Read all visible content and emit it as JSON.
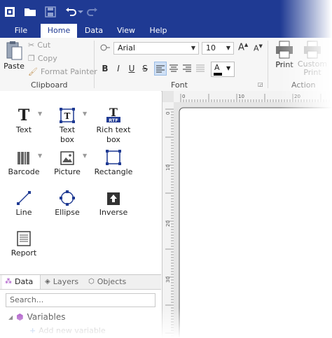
{
  "menu_tabs": [
    {
      "label": "File"
    },
    {
      "label": "Home"
    },
    {
      "label": "Data"
    },
    {
      "label": "View"
    },
    {
      "label": "Help"
    }
  ],
  "clipboard": {
    "paste_label": "Paste",
    "cut_label": "Cut",
    "copy_label": "Copy",
    "format_painter_label": "Format Painter",
    "group_label": "Clipboard"
  },
  "font": {
    "font_name": "Arial",
    "font_size": "10",
    "group_label": "Font",
    "bold": "B",
    "italic": "I",
    "underline": "U",
    "strike": "S",
    "color_letter": "A",
    "grow": "A",
    "shrink": "A"
  },
  "action": {
    "print_label": "Print",
    "custom_print_label": "Custom Print",
    "group_label": "Action"
  },
  "tools": [
    {
      "label": "Text"
    },
    {
      "label": "Text box"
    },
    {
      "label": "Rich text box"
    },
    {
      "label": "Barcode"
    },
    {
      "label": "Picture"
    },
    {
      "label": "Rectangle"
    },
    {
      "label": "Line"
    },
    {
      "label": "Ellipse"
    },
    {
      "label": "Inverse"
    },
    {
      "label": "Report"
    }
  ],
  "rtf_badge": "RTF",
  "ruler": {
    "h_labels": [
      "0",
      "10",
      "20"
    ],
    "v_labels": [
      "0",
      "10",
      "20",
      "30"
    ]
  },
  "bottom_tabs": [
    {
      "label": "Data"
    },
    {
      "label": "Layers"
    },
    {
      "label": "Objects"
    }
  ],
  "search": {
    "placeholder": "Search..."
  },
  "tree": {
    "variables_label": "Variables",
    "add_variable_label": "Add new variable"
  },
  "colors": {
    "titlebar": "#1f3a93",
    "accent": "#1f3a93",
    "variable_icon": "#a040c0"
  }
}
